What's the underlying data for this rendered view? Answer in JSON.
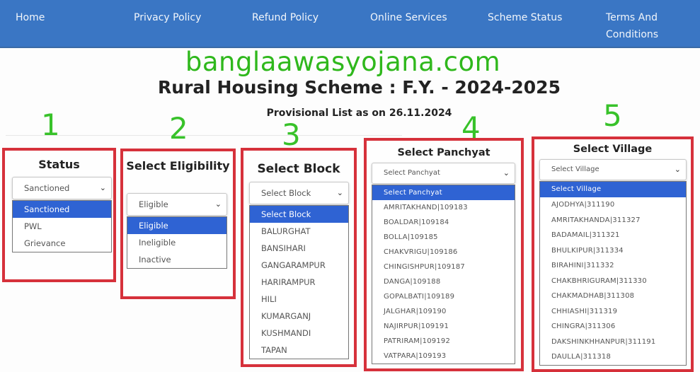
{
  "nav": {
    "items": [
      {
        "label": "Home"
      },
      {
        "label": "Privacy Policy"
      },
      {
        "label": "Refund Policy"
      },
      {
        "label": "Online Services"
      },
      {
        "label": "Scheme Status"
      },
      {
        "label": "Terms And Conditions"
      }
    ]
  },
  "header": {
    "brand": "banglaawasyojana.com",
    "title": "Rural Housing Scheme : F.Y. - 2024-2025",
    "subtitle": "Provisional List as on 26.11.2024"
  },
  "steps": [
    "1",
    "2",
    "3",
    "4",
    "5"
  ],
  "colors": {
    "nav_bg": "#3a76c4",
    "brand_green": "#2fb81c",
    "step_green": "#38c22a",
    "highlight_red": "#d6313b",
    "selected_option": "#2f63d3"
  },
  "panels": {
    "status": {
      "title": "Status",
      "selected": "Sanctioned",
      "options": [
        "Sanctioned",
        "PWL",
        "Grievance"
      ]
    },
    "eligibility": {
      "title": "Select Eligibility",
      "selected": "Eligible",
      "options": [
        "Eligible",
        "Ineligible",
        "Inactive"
      ]
    },
    "block": {
      "title": "Select Block",
      "selected": "Select Block",
      "options": [
        "Select Block",
        "BALURGHAT",
        "BANSIHARI",
        "GANGARAMPUR",
        "HARIRAMPUR",
        "HILI",
        "KUMARGANJ",
        "KUSHMANDI",
        "TAPAN"
      ]
    },
    "panchyat": {
      "title": "Select Panchyat",
      "selected": "Select Panchyat",
      "options": [
        "Select Panchyat",
        "AMRITAKHAND|109183",
        "BOALDAR|109184",
        "BOLLA|109185",
        "CHAKVRIGU|109186",
        "CHINGISHPUR|109187",
        "DANGA|109188",
        "GOPALBATI|109189",
        "JALGHAR|109190",
        "NAJIRPUR|109191",
        "PATRIRAM|109192",
        "VATPARA|109193"
      ]
    },
    "village": {
      "title": "Select Village",
      "selected": "Select Village",
      "options": [
        "Select Village",
        "AJODHYA|311190",
        "AMRITAKHANDA|311327",
        "BADAMAIL|311321",
        "BHULKIPUR|311334",
        "BIRAHINI|311332",
        "CHAKBHRIGURAM|311330",
        "CHAKMADHAB|311308",
        "CHHIASHI|311319",
        "CHINGRA|311306",
        "DAKSHINKHHANPUR|311191",
        "DAULLA|311318"
      ]
    }
  }
}
